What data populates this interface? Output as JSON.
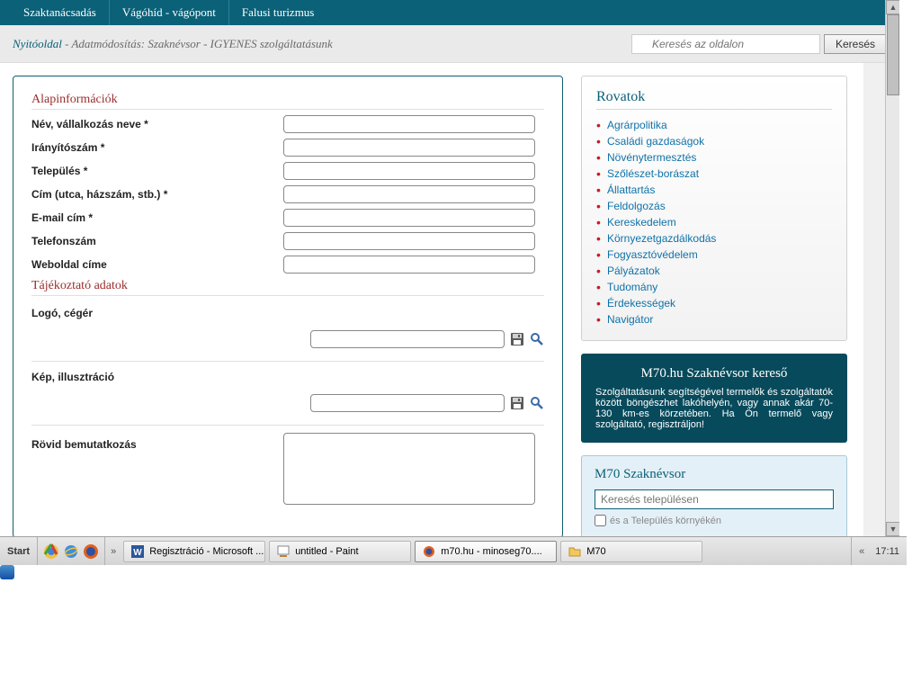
{
  "topnav": {
    "items": [
      "Szaktanácsadás",
      "Vágóhíd - vágópont",
      "Falusi turizmus"
    ]
  },
  "breadcrumb": {
    "home": "Nyitóoldal",
    "rest": " - Adatmódosítás: Szaknévsor - IGYENES szolgáltatásunk"
  },
  "search": {
    "placeholder": "Keresés az oldalon",
    "button": "Keresés"
  },
  "form": {
    "section1": "Alapinformációk",
    "section2": "Tájékoztató adatok",
    "fields": {
      "name": "Név, vállalkozás neve *",
      "zip": "Irányítószám *",
      "city": "Település *",
      "address": "Cím (utca, házszám, stb.) *",
      "email": "E-mail cím *",
      "phone": "Telefonszám",
      "web": "Weboldal címe",
      "logo": "Logó, cégér",
      "image": "Kép, illusztráció",
      "intro": "Rövid bemutatkozás"
    }
  },
  "rovatok": {
    "title": "Rovatok",
    "items": [
      "Agrárpolitika",
      "Családi gazdaságok",
      "Növénytermesztés",
      "Szőlészet-borászat",
      "Állattartás",
      "Feldolgozás",
      "Kereskedelem",
      "Környezetgazdálkodás",
      "Fogyasztóvédelem",
      "Pályázatok",
      "Tudomány",
      "Érdekességek",
      "Navigátor"
    ]
  },
  "promo": {
    "title": "M70.hu Szaknévsor kereső",
    "text": "Szolgáltatásunk segítségével termelők és szolgáltatók között böngészhet lakóhelyén, vagy annak akár 70-130 km-es körzetében. Ha Ön termelő vagy szolgáltató, regisztráljon!"
  },
  "sidesearch": {
    "title": "M70 Szaknévsor",
    "placeholder": "Keresés településen",
    "chk": "és a Település környékén"
  },
  "taskbar": {
    "start": "Start",
    "tasks": [
      {
        "label": "Regisztráció - Microsoft ...",
        "icon": "word"
      },
      {
        "label": "untitled - Paint",
        "icon": "paint"
      },
      {
        "label": "m70.hu - minoseg70....",
        "icon": "firefox",
        "active": true
      },
      {
        "label": "M70",
        "icon": "folder"
      }
    ],
    "clock": "17:11"
  }
}
